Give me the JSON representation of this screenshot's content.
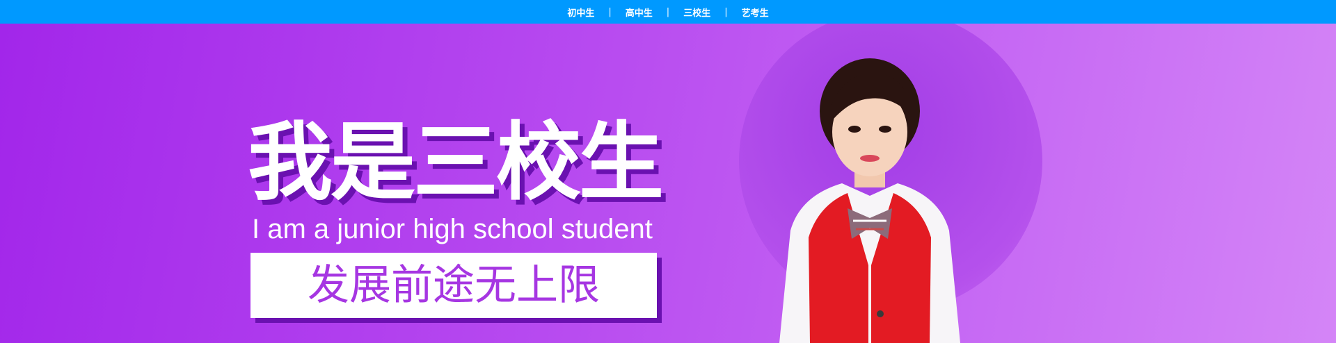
{
  "colors": {
    "nav_bg": "#0099ff",
    "banner_from": "#a226ea",
    "banner_to": "#d485f7",
    "title_shadow": "#6a11b0",
    "slogan_text": "#a636e2",
    "vest": "#e31b23",
    "halo": "#a23de6"
  },
  "nav": {
    "items": [
      {
        "label": "初中生"
      },
      {
        "label": "高中生"
      },
      {
        "label": "三校生"
      },
      {
        "label": "艺考生"
      }
    ],
    "separator": "|"
  },
  "banner": {
    "title": "我是三校生",
    "subtitle": "I am a junior high school student",
    "slogan": "发展前途无上限"
  }
}
